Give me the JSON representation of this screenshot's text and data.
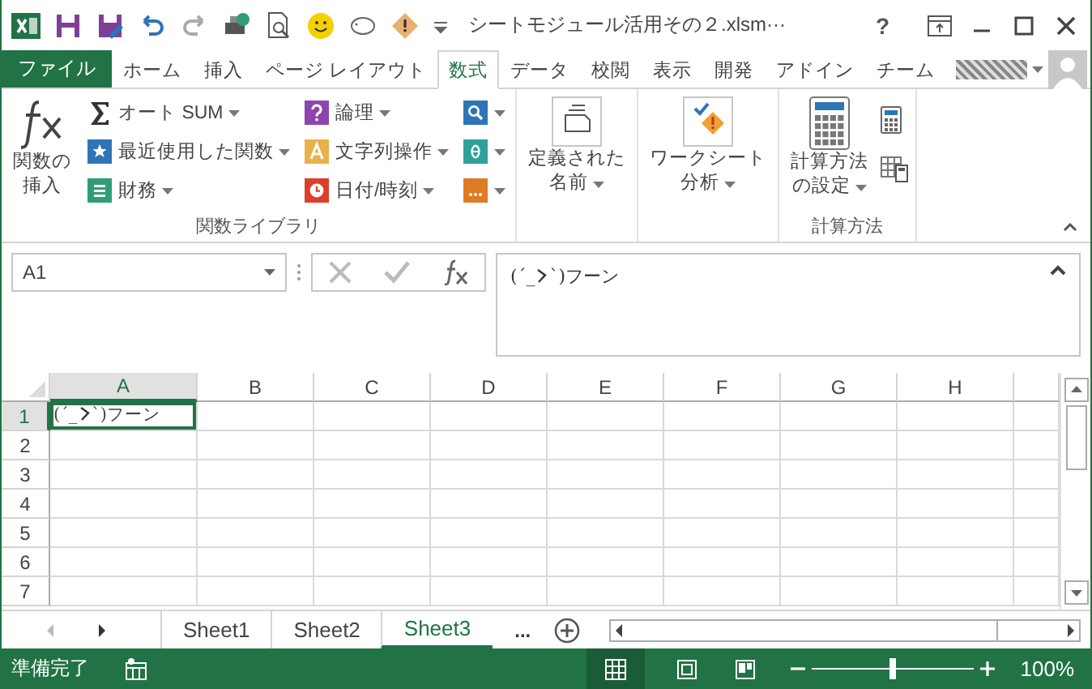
{
  "title_bar": {
    "title": "シートモジュール活用その２.xlsm···",
    "help": "?"
  },
  "tabs": [
    {
      "label": "ファイル",
      "kind": "file",
      "selected": false
    },
    {
      "label": "ホーム",
      "kind": "tab",
      "selected": false
    },
    {
      "label": "挿入",
      "kind": "tab",
      "selected": false
    },
    {
      "label": "ページ レイアウト",
      "kind": "tab",
      "selected": false
    },
    {
      "label": "数式",
      "kind": "tab",
      "selected": true
    },
    {
      "label": "データ",
      "kind": "tab",
      "selected": false
    },
    {
      "label": "校閲",
      "kind": "tab",
      "selected": false
    },
    {
      "label": "表示",
      "kind": "tab",
      "selected": false
    },
    {
      "label": "開発",
      "kind": "tab",
      "selected": false
    },
    {
      "label": "アドイン",
      "kind": "tab",
      "selected": false
    },
    {
      "label": "チーム",
      "kind": "tab",
      "selected": false
    }
  ],
  "ribbon_groups": [
    {
      "label": "関数ライブラリ",
      "items": [
        {
          "kind": "large",
          "lines": [
            "関数の",
            "挿入"
          ],
          "dropdown": false
        },
        {
          "kind": "column",
          "buttons": [
            {
              "label": "オート SUM"
            },
            {
              "label": "最近使用した関数"
            },
            {
              "label": "財務"
            }
          ]
        },
        {
          "kind": "column",
          "buttons": [
            {
              "label": "論理"
            },
            {
              "label": "文字列操作"
            },
            {
              "label": "日付/時刻"
            }
          ]
        },
        {
          "kind": "icon_column"
        }
      ]
    },
    {
      "items": [
        {
          "kind": "large",
          "lines": [
            "定義された",
            "名前"
          ],
          "dropdown": true
        }
      ]
    },
    {
      "items": [
        {
          "kind": "large",
          "lines": [
            "ワークシート",
            "分析"
          ],
          "dropdown": true
        }
      ]
    },
    {
      "label": "計算方法",
      "items": [
        {
          "kind": "large",
          "lines": [
            "計算方法",
            "の設定"
          ],
          "dropdown": true
        },
        {
          "kind": "icons"
        }
      ]
    }
  ],
  "name_box": "A1",
  "formula": {
    "text_parts": [
      "(´_",
      "`)フーン"
    ]
  },
  "columns": [
    {
      "label": "A",
      "selected": true
    },
    {
      "label": "B",
      "selected": false
    },
    {
      "label": "C",
      "selected": false
    },
    {
      "label": "D",
      "selected": false
    },
    {
      "label": "E",
      "selected": false
    },
    {
      "label": "F",
      "selected": false
    },
    {
      "label": "G",
      "selected": false
    },
    {
      "label": "H",
      "selected": false
    }
  ],
  "rows": [
    {
      "label": "1",
      "selected": true,
      "cells": [
        {
          "text_parts": [
            "(´_",
            "`)フーン"
          ]
        }
      ]
    },
    {
      "label": "2",
      "selected": false,
      "cells": []
    },
    {
      "label": "3",
      "selected": false,
      "cells": []
    },
    {
      "label": "4",
      "selected": false,
      "cells": []
    },
    {
      "label": "5",
      "selected": false,
      "cells": []
    },
    {
      "label": "6",
      "selected": false,
      "cells": []
    },
    {
      "label": "7",
      "selected": false,
      "cells": []
    }
  ],
  "sheets": [
    {
      "label": "Sheet1",
      "selected": false
    },
    {
      "label": "Sheet2",
      "selected": false
    },
    {
      "label": "Sheet3",
      "selected": true
    }
  ],
  "more_sheets": "...",
  "status": {
    "text": "準備完了",
    "zoom": "100%",
    "zoom_level": {
      "level": 0.5
    }
  }
}
